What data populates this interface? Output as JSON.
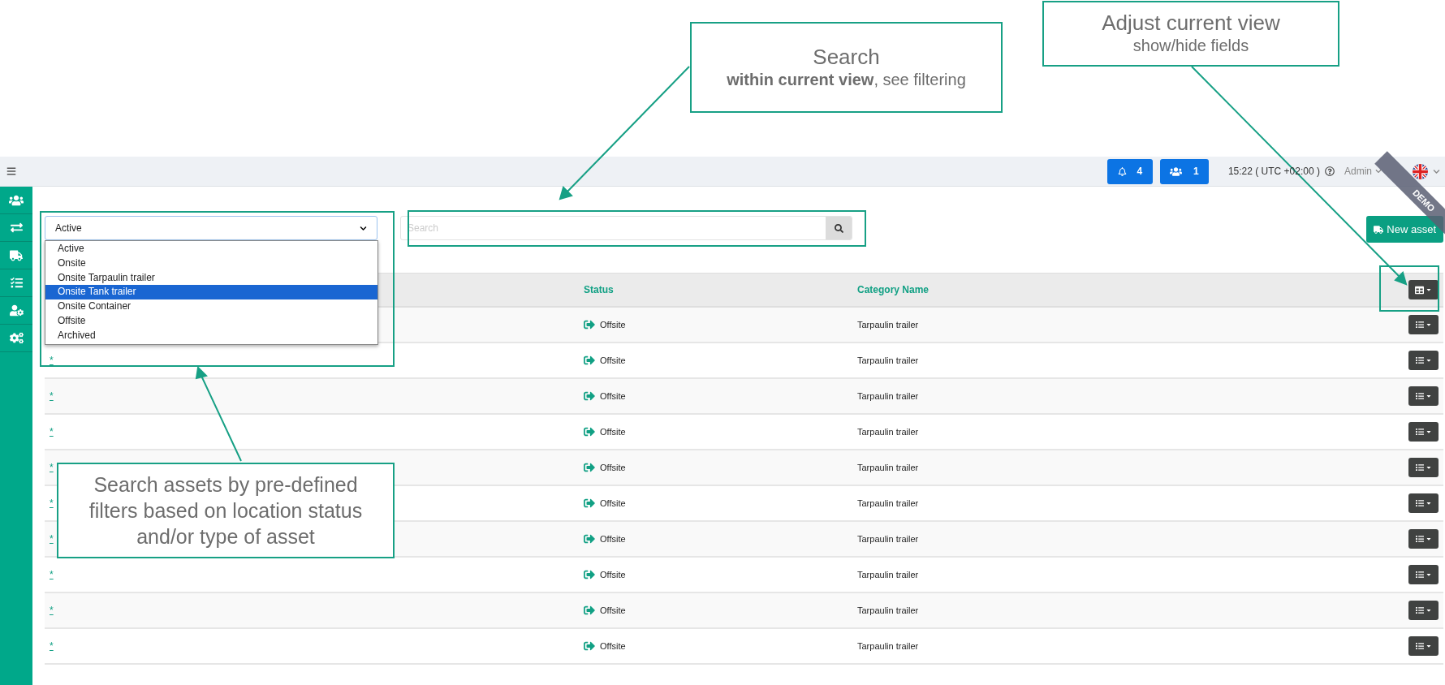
{
  "header": {
    "notifications": "4",
    "users": "1",
    "time": "15:22 ( UTC +02:00 )",
    "user": "Admin",
    "ribbon": "DEMO"
  },
  "sidebar": {
    "items": [
      {
        "kind": "users"
      },
      {
        "kind": "transfer"
      },
      {
        "kind": "trailer"
      },
      {
        "kind": "tasks"
      },
      {
        "kind": "user-pin"
      },
      {
        "kind": "settings"
      }
    ]
  },
  "filter": {
    "value": "Active",
    "options": [
      {
        "label": "Active",
        "highlighted": false
      },
      {
        "label": "Onsite",
        "highlighted": false
      },
      {
        "label": "Onsite Tarpaulin trailer",
        "highlighted": false
      },
      {
        "label": "Onsite Tank trailer",
        "highlighted": true
      },
      {
        "label": "Onsite Container",
        "highlighted": false
      },
      {
        "label": "Offsite",
        "highlighted": false
      },
      {
        "label": "Archived",
        "highlighted": false
      }
    ]
  },
  "search": {
    "placeholder": "Search"
  },
  "new_asset_button": "New asset",
  "table": {
    "columns": [
      "Status",
      "Category Name"
    ],
    "rows": [
      {
        "status": "Offsite",
        "category": "Tarpaulin trailer"
      },
      {
        "name": "*",
        "status": "Offsite",
        "category": "Tarpaulin trailer"
      },
      {
        "name": "*",
        "status": "Offsite",
        "category": "Tarpaulin trailer"
      },
      {
        "name": "*",
        "status": "Offsite",
        "category": "Tarpaulin trailer"
      },
      {
        "name": "*",
        "status": "Offsite",
        "category": "Tarpaulin trailer"
      },
      {
        "name": "*",
        "status": "Offsite",
        "category": "Tarpaulin trailer"
      },
      {
        "name": "*",
        "status": "Offsite",
        "category": "Tarpaulin trailer"
      },
      {
        "name": "*",
        "status": "Offsite",
        "category": "Tarpaulin trailer"
      },
      {
        "name": "*",
        "status": "Offsite",
        "category": "Tarpaulin trailer"
      },
      {
        "name": "*",
        "status": "Offsite",
        "category": "Tarpaulin trailer"
      }
    ]
  },
  "callouts": [
    {
      "title": "Search",
      "text": "**within current view**, see filtering"
    },
    {
      "title": "Adjust current view",
      "text": "show/hide fields"
    },
    {
      "text": "Search assets by pre-defined filters based on location status and/or type of asset"
    }
  ]
}
